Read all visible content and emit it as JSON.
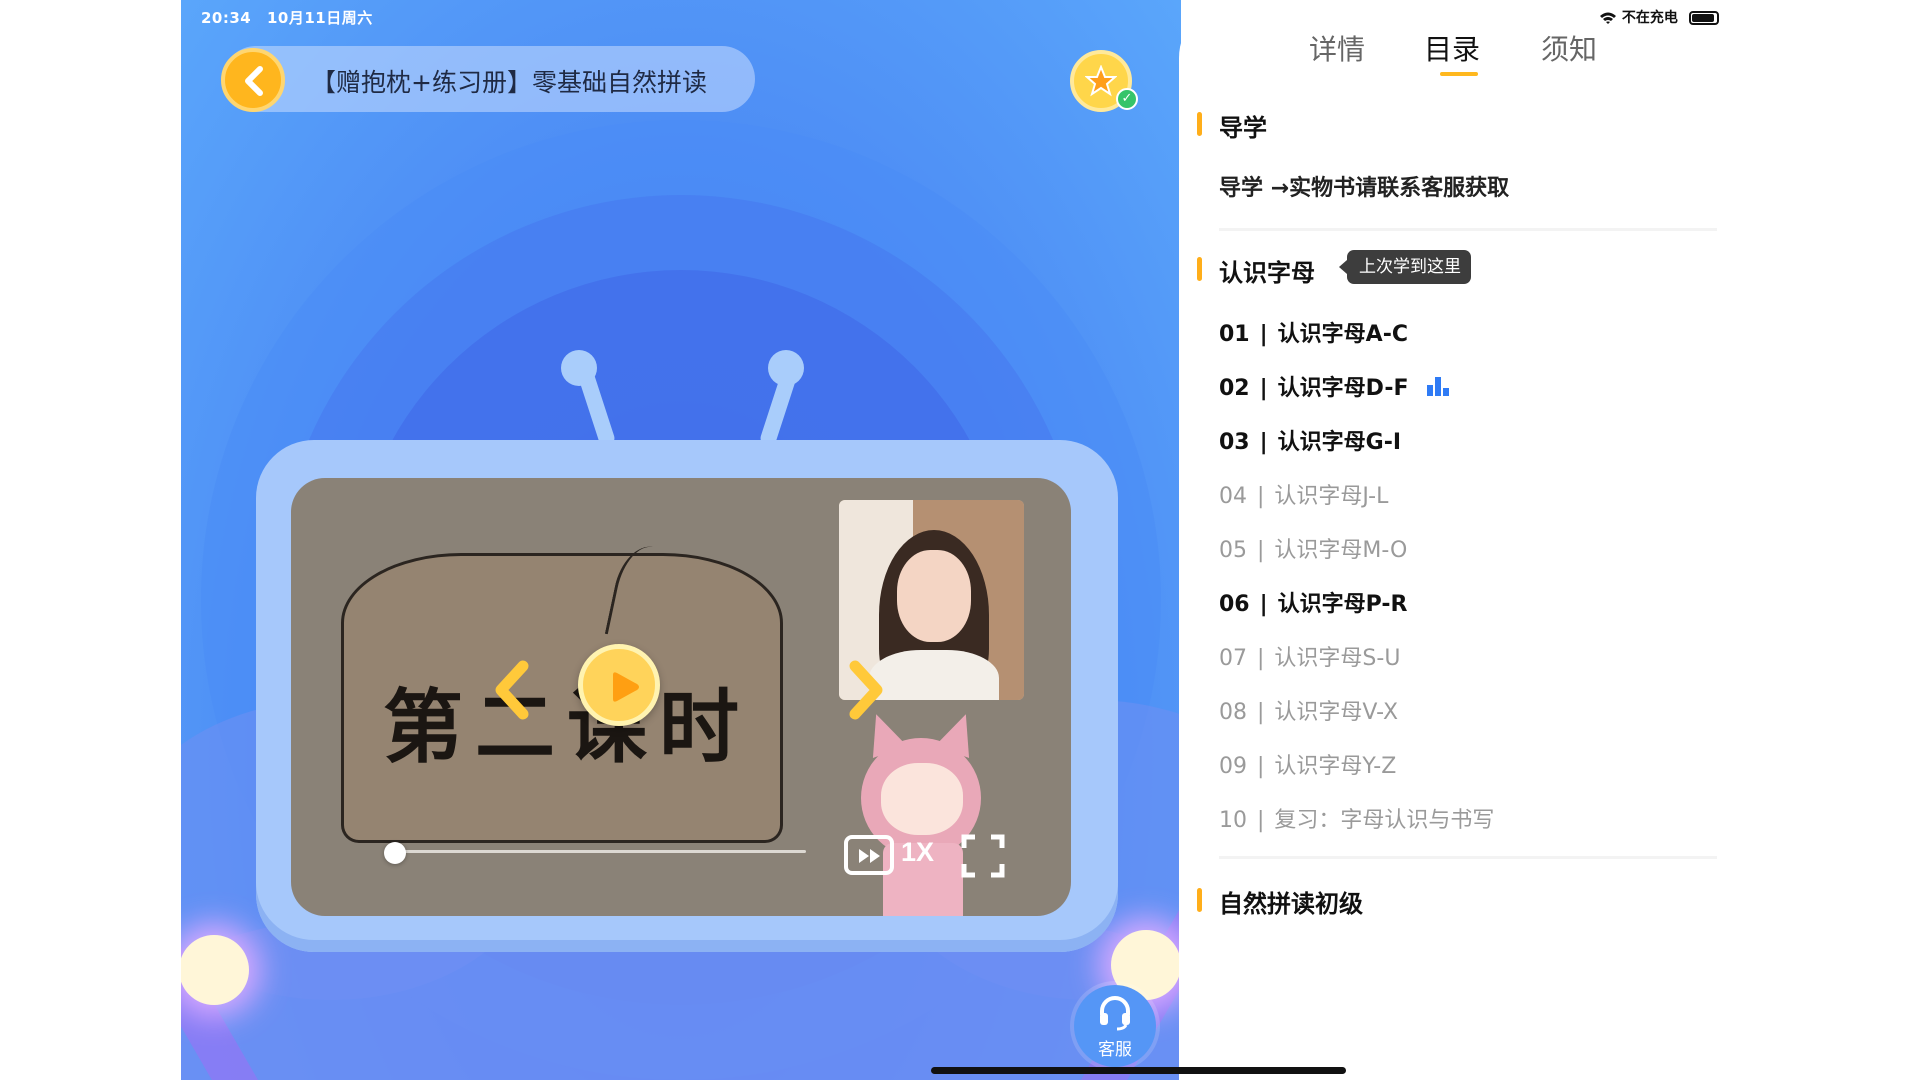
{
  "status_bar": {
    "time": "20:34",
    "date": "10月11日周六",
    "charging": "不在充电"
  },
  "header": {
    "course_title": "【赠抱枕+练习册】零基础自然拼读"
  },
  "video": {
    "slide_text": "第二课时",
    "playback_speed": "1X",
    "progress": 0.0
  },
  "service": {
    "label": "客服"
  },
  "tabs": [
    {
      "label": "详情",
      "selected": false
    },
    {
      "label": "目录",
      "selected": true
    },
    {
      "label": "须知",
      "selected": false
    }
  ],
  "sections": [
    {
      "title": "导学",
      "items": [
        {
          "label": "导学 →实物书请联系客服获取"
        }
      ]
    },
    {
      "title": "认识字母",
      "badge": "上次学到这里",
      "lessons": [
        {
          "num": "01",
          "title": "认识字母A-C",
          "active": true
        },
        {
          "num": "02",
          "title": "认识字母D-F",
          "active": true,
          "playing": true
        },
        {
          "num": "03",
          "title": "认识字母G-I",
          "active": true
        },
        {
          "num": "04",
          "title": "认识字母J-L",
          "active": false
        },
        {
          "num": "05",
          "title": "认识字母M-O",
          "active": false
        },
        {
          "num": "06",
          "title": "认识字母P-R",
          "active": true
        },
        {
          "num": "07",
          "title": "认识字母S-U",
          "active": false
        },
        {
          "num": "08",
          "title": "认识字母V-X",
          "active": false
        },
        {
          "num": "09",
          "title": "认识字母Y-Z",
          "active": false
        },
        {
          "num": "10",
          "title": "复习：字母认识与书写",
          "active": false
        }
      ]
    },
    {
      "title": "自然拼读初级"
    }
  ],
  "colors": {
    "accent": "#ffb81e",
    "player_bg": "#4a86f3",
    "playing_icon": "#2f7bf5"
  }
}
